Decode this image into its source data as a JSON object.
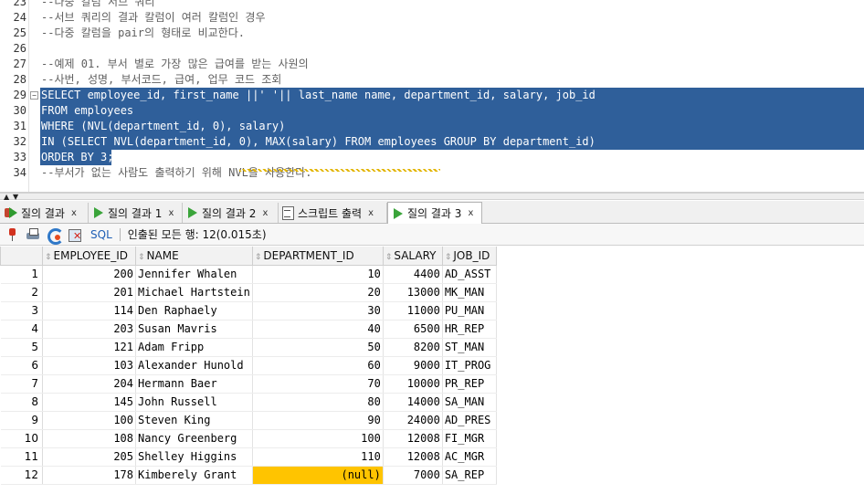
{
  "editor": {
    "lines": [
      {
        "n": "23",
        "text": "--다중 칼럼 서브 쿼리",
        "comment": true,
        "selected": false
      },
      {
        "n": "24",
        "text": "--서브 쿼리의 결과 칼럼이 여러 칼럼인 경우",
        "comment": true,
        "selected": false
      },
      {
        "n": "25",
        "text": "--다중 칼럼을 pair의 형태로 비교한다.",
        "comment": true,
        "selected": false
      },
      {
        "n": "26",
        "text": "",
        "comment": false,
        "selected": false
      },
      {
        "n": "27",
        "text": "--예제 01. 부서 별로 가장 많은 급여를 받는 사원의",
        "comment": true,
        "selected": false
      },
      {
        "n": "28",
        "text": "--사번, 성명, 부서코드, 급여, 업무 코드 조회",
        "comment": true,
        "selected": false
      },
      {
        "n": "29",
        "text": "SELECT employee_id, first_name ||' '|| last_name name, department_id, salary, job_id",
        "comment": false,
        "selected": true
      },
      {
        "n": "30",
        "text": "FROM employees",
        "comment": false,
        "selected": true
      },
      {
        "n": "31",
        "text": "WHERE (NVL(department_id, 0), salary)",
        "comment": false,
        "selected": true
      },
      {
        "n": "32",
        "text": "IN (SELECT NVL(department_id, 0), MAX(salary) FROM employees GROUP BY department_id)",
        "comment": false,
        "selected": true
      },
      {
        "n": "33",
        "text": "ORDER BY 3;",
        "comment": false,
        "selected": true
      },
      {
        "n": "34",
        "text": "--부서가 없는 사람도 출력하기 위해 NVL을 사용한다.",
        "comment": true,
        "selected": false
      }
    ]
  },
  "tabs": [
    {
      "label": "질의 결과",
      "icon": "stop-play-icon",
      "active": false
    },
    {
      "label": "질의 결과 1",
      "icon": "play-icon",
      "active": false
    },
    {
      "label": "질의 결과 2",
      "icon": "play-icon",
      "active": false
    },
    {
      "label": "스크립트 출력",
      "icon": "script-icon",
      "active": false
    },
    {
      "label": "질의 결과 3",
      "icon": "play-icon",
      "active": true
    }
  ],
  "tab_close": "x",
  "toolbar": {
    "sql_label": "SQL",
    "status": "인출된 모든 행: 12(0.015초)"
  },
  "grid": {
    "columns": [
      "EMPLOYEE_ID",
      "NAME",
      "DEPARTMENT_ID",
      "SALARY",
      "JOB_ID"
    ],
    "rows": [
      {
        "n": "1",
        "employee_id": "200",
        "name": "Jennifer Whalen",
        "department_id": "10",
        "salary": "4400",
        "job_id": "AD_ASST"
      },
      {
        "n": "2",
        "employee_id": "201",
        "name": "Michael Hartstein",
        "department_id": "20",
        "salary": "13000",
        "job_id": "MK_MAN"
      },
      {
        "n": "3",
        "employee_id": "114",
        "name": "Den Raphaely",
        "department_id": "30",
        "salary": "11000",
        "job_id": "PU_MAN"
      },
      {
        "n": "4",
        "employee_id": "203",
        "name": "Susan Mavris",
        "department_id": "40",
        "salary": "6500",
        "job_id": "HR_REP"
      },
      {
        "n": "5",
        "employee_id": "121",
        "name": "Adam Fripp",
        "department_id": "50",
        "salary": "8200",
        "job_id": "ST_MAN"
      },
      {
        "n": "6",
        "employee_id": "103",
        "name": "Alexander Hunold",
        "department_id": "60",
        "salary": "9000",
        "job_id": "IT_PROG"
      },
      {
        "n": "7",
        "employee_id": "204",
        "name": "Hermann Baer",
        "department_id": "70",
        "salary": "10000",
        "job_id": "PR_REP"
      },
      {
        "n": "8",
        "employee_id": "145",
        "name": "John Russell",
        "department_id": "80",
        "salary": "14000",
        "job_id": "SA_MAN"
      },
      {
        "n": "9",
        "employee_id": "100",
        "name": "Steven King",
        "department_id": "90",
        "salary": "24000",
        "job_id": "AD_PRES"
      },
      {
        "n": "10",
        "employee_id": "108",
        "name": "Nancy Greenberg",
        "department_id": "100",
        "salary": "12008",
        "job_id": "FI_MGR"
      },
      {
        "n": "11",
        "employee_id": "205",
        "name": "Shelley Higgins",
        "department_id": "110",
        "salary": "12008",
        "job_id": "AC_MGR"
      },
      {
        "n": "12",
        "employee_id": "178",
        "name": "Kimberely Grant",
        "department_id": "(null)",
        "salary": "7000",
        "job_id": "SA_REP"
      }
    ]
  },
  "colors": {
    "selection": "#2f5f9a",
    "null_highlight": "#ffc400",
    "comment": "#5f5f5f"
  }
}
